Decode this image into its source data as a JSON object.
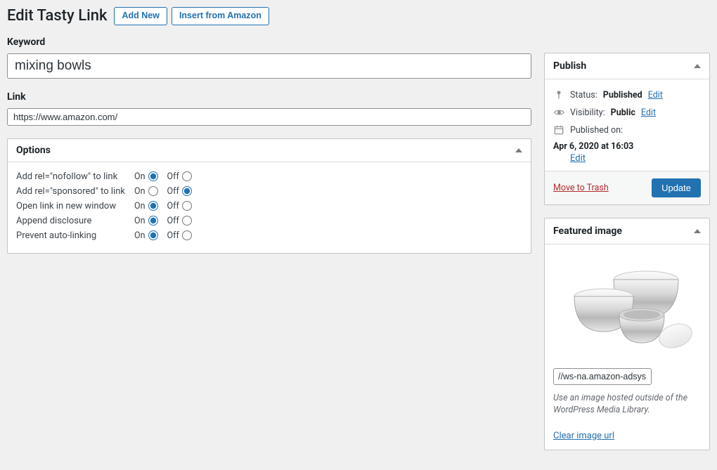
{
  "header": {
    "title": "Edit Tasty Link",
    "add_new": "Add New",
    "insert_amazon": "Insert from Amazon"
  },
  "fields": {
    "keyword_label": "Keyword",
    "keyword_value": "mixing bowls",
    "link_label": "Link",
    "link_value": "https://www.amazon.com/"
  },
  "options": {
    "panel_title": "Options",
    "on": "On",
    "off": "Off",
    "rows": [
      {
        "label": "Add rel=\"nofollow\" to link",
        "value": "on"
      },
      {
        "label": "Add rel=\"sponsored\" to link",
        "value": "off"
      },
      {
        "label": "Open link in new window",
        "value": "on"
      },
      {
        "label": "Append disclosure",
        "value": "on"
      },
      {
        "label": "Prevent auto-linking",
        "value": "on"
      }
    ]
  },
  "publish": {
    "panel_title": "Publish",
    "status_label": "Status:",
    "status_value": "Published",
    "visibility_label": "Visibility:",
    "visibility_value": "Public",
    "published_on_label": "Published on:",
    "published_on_value": "Apr 6, 2020 at 16:03",
    "edit": "Edit",
    "move_to_trash": "Move to Trash",
    "update": "Update"
  },
  "featured": {
    "panel_title": "Featured image",
    "url_value": "//ws-na.amazon-adsys",
    "help_text": "Use an image hosted outside of the WordPress Media Library.",
    "clear": "Clear image url"
  }
}
